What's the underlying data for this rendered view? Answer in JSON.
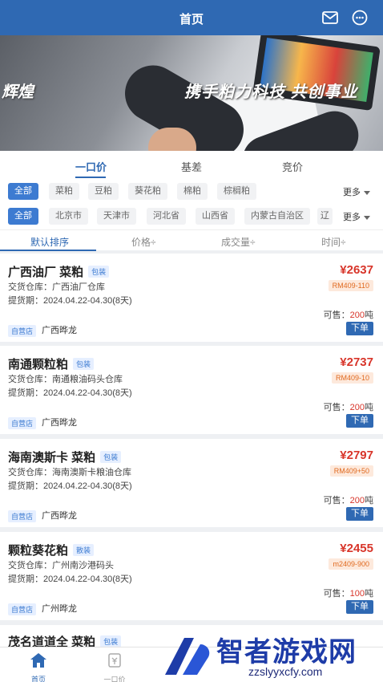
{
  "header": {
    "title": "首页",
    "icons": [
      "mail-icon",
      "chat-bubble-icon"
    ]
  },
  "banner": {
    "left_text": "辉煌",
    "right_text": "携手粕力科技 共创事业"
  },
  "tabs": [
    {
      "label": "一口价",
      "active": true
    },
    {
      "label": "基差",
      "active": false
    },
    {
      "label": "竞价",
      "active": false
    }
  ],
  "categories": {
    "items": [
      "全部",
      "菜粕",
      "豆粕",
      "葵花粕",
      "棉粕",
      "棕榈粕"
    ],
    "more": "更多"
  },
  "regions": {
    "items": [
      "全部",
      "北京市",
      "天津市",
      "河北省",
      "山西省",
      "内蒙古自治区",
      "辽"
    ],
    "more": "更多"
  },
  "sort": [
    {
      "label": "默认排序",
      "active": true
    },
    {
      "label": "价格÷"
    },
    {
      "label": "成交量÷"
    },
    {
      "label": "时间÷"
    }
  ],
  "listings": [
    {
      "name": "广西油厂 菜粕",
      "tag": "包装",
      "warehouse": "交货仓库：广西油厂仓库",
      "period": "提货期：2024.04.22-04.30(8天)",
      "price": "¥2637",
      "contract": "RM409-110",
      "avail_prefix": "可售：",
      "avail_qty": "200",
      "avail_unit": "吨",
      "badge": "自营店",
      "seller": "广西晔龙",
      "order": "下单"
    },
    {
      "name": "南通颗粒粕",
      "tag": "包装",
      "warehouse": "交货仓库：南通粮油码头仓库",
      "period": "提货期：2024.04.22-04.30(8天)",
      "price": "¥2737",
      "contract": "RM409-10",
      "avail_prefix": "可售：",
      "avail_qty": "200",
      "avail_unit": "吨",
      "badge": "自营店",
      "seller": "广西晔龙",
      "order": "下单"
    },
    {
      "name": "海南澳斯卡 菜粕",
      "tag": "包装",
      "warehouse": "交货仓库：海南澳斯卡粮油仓库",
      "period": "提货期：2024.04.22-04.30(8天)",
      "price": "¥2797",
      "contract": "RM409+50",
      "avail_prefix": "可售：",
      "avail_qty": "200",
      "avail_unit": "吨",
      "badge": "自营店",
      "seller": "广西晔龙",
      "order": "下单"
    },
    {
      "name": "颗粒葵花粕",
      "tag": "散装",
      "warehouse": "交货仓库：广州南沙港码头",
      "period": "提货期：2024.04.22-04.30(8天)",
      "price": "¥2455",
      "contract": "m2409-900",
      "avail_prefix": "可售：",
      "avail_qty": "100",
      "avail_unit": "吨",
      "badge": "自营店",
      "seller": "广州晔龙",
      "order": "下单"
    },
    {
      "name": "茂名道道全 菜粕",
      "tag": "包装"
    }
  ],
  "bottom_nav": [
    {
      "label": "首页",
      "icon": "home-icon",
      "active": true
    },
    {
      "label": "一口价",
      "icon": "price-tag-icon",
      "active": false
    }
  ],
  "watermark": {
    "brand": "智者游戏网",
    "url": "zzslyyxcfy.com"
  },
  "colors": {
    "primary": "#2f69b3",
    "price": "#d8352a",
    "chip_active": "#3d7bd1"
  }
}
